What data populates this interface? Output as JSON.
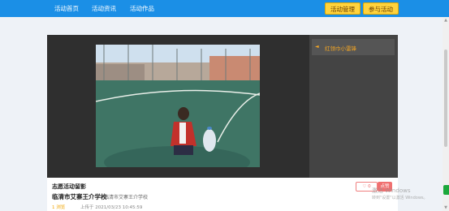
{
  "nav": {
    "items": [
      "活动首页",
      "活动资讯",
      "活动作品"
    ],
    "manage_label": "活动管理",
    "join_label": "参与活动"
  },
  "sidebar": {
    "items": [
      {
        "label": "红领巾小雷锋",
        "selected": true
      }
    ]
  },
  "work": {
    "category": "志愿活动留影",
    "school": "临清市艾寨王介学校",
    "school_sub": "临清市艾寨王介学校",
    "views": "1 浏览",
    "upload_time": "上传于 2021/03/23 10:45:59",
    "like_label": "0",
    "comment_label": "点赞"
  },
  "os_watermark": {
    "line1": "激活 Windows",
    "line2": "转到\"设置\"以激活 Windows。"
  },
  "colors": {
    "topbar": "#1b8fe6",
    "accent_button": "#ffd33d",
    "side_highlight": "#f5a623",
    "like": "#f07070"
  }
}
